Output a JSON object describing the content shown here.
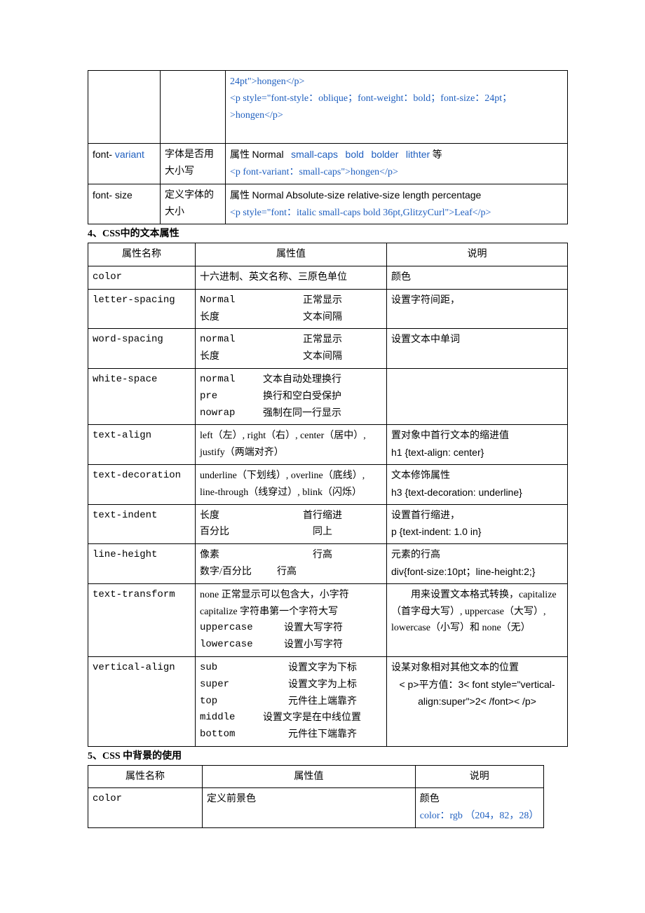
{
  "table1": {
    "row1": {
      "example1": "24pt\">hongen</p>",
      "example2a": "<p style=\"font-style：oblique；font-weight：bold；font-size：24pt；",
      "example2b": ">hongen</p>"
    },
    "row2": {
      "name_a": "font- ",
      "name_b": "variant",
      "desc": "字体是否用大小写",
      "val_prefix": "属性",
      "val_normal": "Normal",
      "val_b": "small-caps",
      "val_c": "bold",
      "val_d": "bolder",
      "val_e": "lithter",
      "val_suffix": "等",
      "example": "<p   font-variant：small-caps\">hongen</p>"
    },
    "row3": {
      "name": "font- size",
      "desc": "定义字体的大小",
      "val_prefix": "属性",
      "val_rest": "Normal Absolute-size    relative-size length percentage",
      "example": "<p style=\"font：italic small-caps bold 36pt,GlitzyCurl\">Leaf</p>"
    }
  },
  "sec4_title": "4、CSS中的文本属性",
  "table2": {
    "hdr": {
      "c1": "属性名称",
      "c2": "属性值",
      "c3": "说明"
    },
    "r1": {
      "name": "color",
      "val": "十六进制、英文名称、三原色单位",
      "desc": "颜色"
    },
    "r2": {
      "name": "letter-spacing",
      "k1": "Normal",
      "v1": "正常显示",
      "k2": "长度",
      "v2": "文本间隔",
      "desc": "设置字符间距，"
    },
    "r3": {
      "name": "word-spacing",
      "k1": "normal",
      "v1": "正常显示",
      "k2": "长度",
      "v2": "文本间隔",
      "desc": "设置文本中单词"
    },
    "r4": {
      "name": "white-space",
      "k1": "normal",
      "v1": "文本自动处理换行",
      "k2": "pre",
      "v2": "换行和空白受保护",
      "k3": "nowrap",
      "v3": "强制在同一行显示"
    },
    "r5": {
      "name": "text-align",
      "val": "left（左）, right（右）, center（居中）, justify（两端对齐）",
      "desc_a": "置对象中首行文本的缩进值",
      "desc_b": "h1 {text-align: center}"
    },
    "r6": {
      "name": "text-decoration",
      "val": "underline（下划线）, overline（底线）, line-through（线穿过）, blink（闪烁）",
      "desc_a": "文本修饰属性",
      "desc_b": "h3 {text-decoration: underline}"
    },
    "r7": {
      "name": "text-indent",
      "k1": "长度",
      "v1": "首行缩进",
      "k2": "百分比",
      "v2": "同上",
      "desc_a": "设置首行缩进，",
      "desc_b": "p {text-indent: 1.0 in}"
    },
    "r8": {
      "name": "line-height",
      "k1": "像素",
      "v1": "行高",
      "k2": "数字/百分比",
      "v2": "行高",
      "desc_a": "元素的行高",
      "desc_b": "div{font-size:10pt；line-height:2;}"
    },
    "r9": {
      "name": "text-transform",
      "line1": "none 正常显示可以包含大，小字符",
      "line2": "capitalize 字符串第一个字符大写",
      "k3": "uppercase",
      "v3": "设置大写字符",
      "k4": "lowercase",
      "v4": "设置小写字符",
      "desc": "用来设置文本格式转换，capitalize（首字母大写）, uppercase（大写）, lowercase（小写）和 none（无）"
    },
    "r10": {
      "name": "vertical-align",
      "k1": "sub",
      "v1": "设置文字为下标",
      "k2": "super",
      "v2": "设置文字为上标",
      "k3": "top",
      "v3": "元件往上端靠齐",
      "k4": "middle",
      "v4": "设置文字是在中线位置",
      "k5": "bottom",
      "v5": "元件往下端靠齐",
      "desc_a": "设某对象相对其他文本的位置",
      "desc_b": "< p>平方值：3< font style=\"vertical-align:super\">2< /font>< /p>"
    }
  },
  "sec5_title": "5、CSS 中背景的使用",
  "table3": {
    "hdr": {
      "c1": "属性名称",
      "c2": "属性值",
      "c3": "说明"
    },
    "r1": {
      "name": "color",
      "val": "定义前景色",
      "desc_a": "颜色",
      "desc_b": "color：rgb （204，82，28）"
    }
  }
}
